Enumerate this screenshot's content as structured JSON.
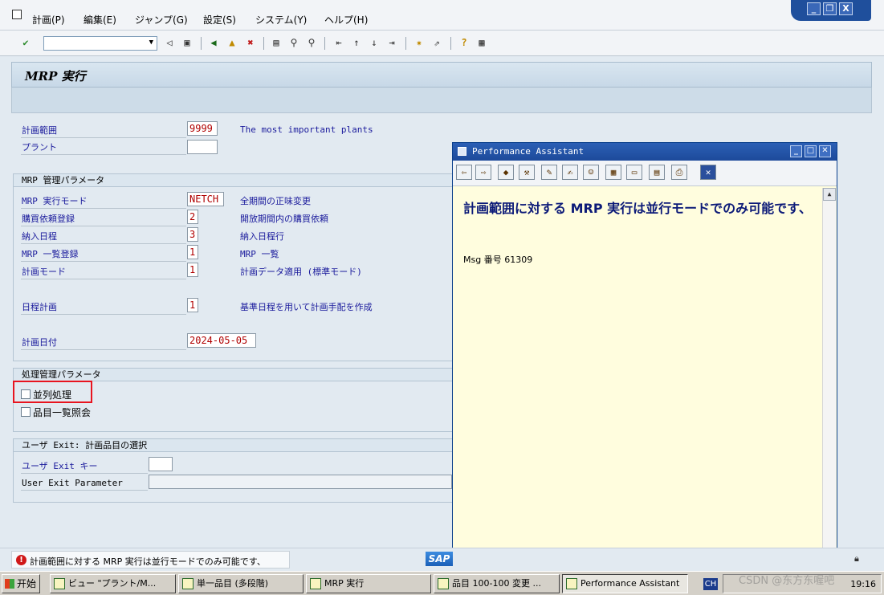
{
  "menu": {
    "items": [
      "計画(P)",
      "編集(E)",
      "ジャンプ(G)",
      "設定(S)",
      "システム(Y)",
      "ヘルプ(H)"
    ]
  },
  "window_controls": [
    "_",
    "❐",
    "X"
  ],
  "toolbar": {
    "command_field_value": "",
    "icons": [
      "enter-icon",
      "back-icon",
      "save-icon",
      "green-back-icon",
      "exit-icon",
      "cancel-icon",
      "print-icon",
      "find-icon",
      "find-next-icon",
      "first-page-icon",
      "prev-page-icon",
      "next-page-icon",
      "last-page-icon",
      "new-session-icon",
      "shortcut-icon",
      "help-icon",
      "layout-icon"
    ]
  },
  "page": {
    "title": "MRP 実行"
  },
  "fields": {
    "planning_scope": {
      "label": "計画範囲",
      "value": "9999",
      "desc": "The most important plants"
    },
    "plant": {
      "label": "プラント",
      "value": ""
    }
  },
  "mrp_group": {
    "title": "MRP 管理パラメータ",
    "rows": [
      {
        "label": "MRP 実行モード",
        "value": "NETCH",
        "desc": "全期間の正味変更"
      },
      {
        "label": "購買依頼登録",
        "value": "2",
        "desc": "開放期間内の購買依頼"
      },
      {
        "label": "納入日程",
        "value": "3",
        "desc": "納入日程行"
      },
      {
        "label": "MRP 一覧登録",
        "value": "1",
        "desc": "MRP 一覧"
      },
      {
        "label": "計画モード",
        "value": "1",
        "desc": "計画データ適用 (標準モード)"
      },
      {
        "label": "日程計画",
        "value": "1",
        "desc": "基準日程を用いて計画手配を作成"
      },
      {
        "label": "計画日付",
        "value": "2024-05-05",
        "desc": ""
      }
    ]
  },
  "process_group": {
    "title": "処理管理パラメータ",
    "checks": [
      {
        "label": "並列処理",
        "checked": false
      },
      {
        "label": "品目一覧照会",
        "checked": false
      }
    ]
  },
  "user_exit_group": {
    "title": "ユーザ Exit: 計画品目の選択",
    "exit_key_label": "ユーザ Exit キー",
    "exit_key_value": "",
    "param_label": "User Exit Parameter",
    "param_value": ""
  },
  "performance_assistant": {
    "title": "Performance Assistant",
    "heading": "計画範囲に対する MRP 実行は並行モードでのみ可能です、",
    "msg": "Msg 番号 61309"
  },
  "status": {
    "message": "計画範囲に対する MRP 実行は並行モードでのみ可能です、",
    "logo": "SAP"
  },
  "taskbar": {
    "start": "开始",
    "tasks": [
      "ビュー \"プラント/M...",
      "単一品目 (多段階)",
      "MRP 実行",
      "品目 100-100 変更 ...",
      "Performance Assistant"
    ],
    "lang": "CH",
    "clock": "19:16"
  },
  "watermark": "CSDN @东方东喔吧"
}
